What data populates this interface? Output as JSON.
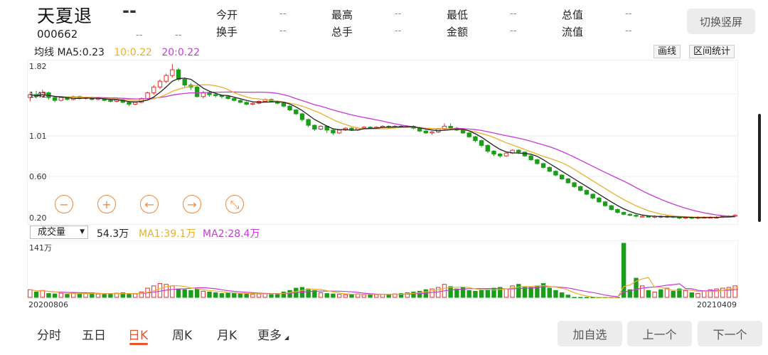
{
  "header": {
    "name": "天夏退",
    "price": "--",
    "code": "000662",
    "change": "--",
    "change_pct": "--",
    "quotes": [
      {
        "label": "今开",
        "value": "--"
      },
      {
        "label": "最高",
        "value": "--"
      },
      {
        "label": "最低",
        "value": "--"
      },
      {
        "label": "总值",
        "value": "--"
      },
      {
        "label": "换手",
        "value": "--"
      },
      {
        "label": "总手",
        "value": "--"
      },
      {
        "label": "金额",
        "value": "--"
      },
      {
        "label": "流值",
        "value": "--"
      }
    ],
    "switch_button": "切换竖屏"
  },
  "ma": {
    "label": "均线",
    "ma5": "MA5:0.23",
    "ma10": "10:0.22",
    "ma20": "20:0.22",
    "draw_button": "画线",
    "range_button": "区间统计"
  },
  "price_axis": [
    "1.82",
    "1.42",
    "1.01",
    "0.60",
    "0.20"
  ],
  "controls": [
    {
      "name": "zoom-out-icon",
      "glyph": "−"
    },
    {
      "name": "zoom-in-icon",
      "glyph": "+"
    },
    {
      "name": "arrow-left-icon",
      "glyph": "←"
    },
    {
      "name": "arrow-right-icon",
      "glyph": "→"
    },
    {
      "name": "collapse-icon",
      "glyph": "⤡"
    }
  ],
  "volume": {
    "selector": "成交量",
    "value": "54.3万",
    "ma1": "MA1:39.1万",
    "ma2": "MA2:28.4万",
    "max_label": "141万"
  },
  "dates": {
    "start": "20200806",
    "end": "20210409"
  },
  "tabs": [
    "分时",
    "五日",
    "日K",
    "周K",
    "月K",
    "更多"
  ],
  "active_tab": "日K",
  "buttons": {
    "watchlist": "加自选",
    "prev": "上一个",
    "next": "下一个"
  },
  "colors": {
    "up": "#e0312f",
    "down": "#1a9e1a",
    "ma5": "#222222",
    "ma10": "#e9b02e",
    "ma20": "#c83ad8",
    "accent": "#e8542c"
  },
  "chart_data": {
    "type": "candlestick",
    "price_ylim": [
      0.2,
      1.82
    ],
    "candles": [
      [
        1.47,
        1.5,
        1.43,
        1.52
      ],
      [
        1.5,
        1.48,
        1.46,
        1.54
      ],
      [
        1.48,
        1.52,
        1.47,
        1.55
      ],
      [
        1.52,
        1.47,
        1.45,
        1.53
      ],
      [
        1.47,
        1.44,
        1.42,
        1.49
      ],
      [
        1.44,
        1.47,
        1.43,
        1.48
      ],
      [
        1.47,
        1.45,
        1.44,
        1.48
      ],
      [
        1.45,
        1.48,
        1.44,
        1.49
      ],
      [
        1.48,
        1.46,
        1.45,
        1.49
      ],
      [
        1.46,
        1.47,
        1.45,
        1.48
      ],
      [
        1.47,
        1.45,
        1.44,
        1.48
      ],
      [
        1.45,
        1.46,
        1.44,
        1.47
      ],
      [
        1.46,
        1.44,
        1.43,
        1.47
      ],
      [
        1.44,
        1.43,
        1.42,
        1.45
      ],
      [
        1.43,
        1.45,
        1.42,
        1.46
      ],
      [
        1.45,
        1.42,
        1.41,
        1.46
      ],
      [
        1.42,
        1.4,
        1.38,
        1.43
      ],
      [
        1.4,
        1.42,
        1.39,
        1.43
      ],
      [
        1.42,
        1.46,
        1.41,
        1.47
      ],
      [
        1.46,
        1.52,
        1.45,
        1.53
      ],
      [
        1.52,
        1.58,
        1.5,
        1.6
      ],
      [
        1.58,
        1.64,
        1.56,
        1.66
      ],
      [
        1.64,
        1.7,
        1.62,
        1.72
      ],
      [
        1.7,
        1.76,
        1.68,
        1.82
      ],
      [
        1.76,
        1.66,
        1.64,
        1.78
      ],
      [
        1.66,
        1.6,
        1.58,
        1.68
      ],
      [
        1.6,
        1.58,
        1.55,
        1.62
      ],
      [
        1.58,
        1.48,
        1.47,
        1.6
      ],
      [
        1.48,
        1.52,
        1.46,
        1.54
      ],
      [
        1.52,
        1.5,
        1.48,
        1.54
      ],
      [
        1.5,
        1.49,
        1.47,
        1.52
      ],
      [
        1.49,
        1.48,
        1.46,
        1.5
      ],
      [
        1.48,
        1.46,
        1.45,
        1.49
      ],
      [
        1.46,
        1.44,
        1.43,
        1.47
      ],
      [
        1.44,
        1.42,
        1.41,
        1.45
      ],
      [
        1.42,
        1.4,
        1.39,
        1.43
      ],
      [
        1.4,
        1.41,
        1.39,
        1.42
      ],
      [
        1.41,
        1.43,
        1.4,
        1.44
      ],
      [
        1.43,
        1.45,
        1.42,
        1.46
      ],
      [
        1.45,
        1.43,
        1.42,
        1.46
      ],
      [
        1.43,
        1.41,
        1.4,
        1.44
      ],
      [
        1.41,
        1.38,
        1.37,
        1.42
      ],
      [
        1.38,
        1.34,
        1.33,
        1.39
      ],
      [
        1.34,
        1.3,
        1.29,
        1.35
      ],
      [
        1.3,
        1.24,
        1.22,
        1.31
      ],
      [
        1.24,
        1.18,
        1.16,
        1.25
      ],
      [
        1.18,
        1.14,
        1.12,
        1.19
      ],
      [
        1.14,
        1.17,
        1.13,
        1.18
      ],
      [
        1.17,
        1.13,
        1.1,
        1.18
      ],
      [
        1.13,
        1.1,
        1.08,
        1.14
      ],
      [
        1.1,
        1.13,
        1.09,
        1.14
      ],
      [
        1.13,
        1.15,
        1.12,
        1.16
      ],
      [
        1.15,
        1.13,
        1.12,
        1.16
      ],
      [
        1.13,
        1.15,
        1.12,
        1.16
      ],
      [
        1.15,
        1.16,
        1.14,
        1.17
      ],
      [
        1.16,
        1.15,
        1.14,
        1.17
      ],
      [
        1.15,
        1.16,
        1.14,
        1.17
      ],
      [
        1.16,
        1.17,
        1.15,
        1.18
      ],
      [
        1.17,
        1.16,
        1.15,
        1.18
      ],
      [
        1.16,
        1.17,
        1.15,
        1.18
      ],
      [
        1.17,
        1.16,
        1.15,
        1.18
      ],
      [
        1.16,
        1.17,
        1.15,
        1.18
      ],
      [
        1.17,
        1.15,
        1.14,
        1.18
      ],
      [
        1.15,
        1.12,
        1.11,
        1.16
      ],
      [
        1.12,
        1.1,
        1.09,
        1.13
      ],
      [
        1.1,
        1.11,
        1.08,
        1.12
      ],
      [
        1.11,
        1.14,
        1.1,
        1.15
      ],
      [
        1.14,
        1.17,
        1.13,
        1.2
      ],
      [
        1.17,
        1.15,
        1.13,
        1.2
      ],
      [
        1.15,
        1.13,
        1.12,
        1.16
      ],
      [
        1.13,
        1.1,
        1.09,
        1.14
      ],
      [
        1.1,
        1.06,
        1.05,
        1.11
      ],
      [
        1.06,
        1.02,
        1.0,
        1.07
      ],
      [
        1.02,
        0.97,
        0.95,
        1.03
      ],
      [
        0.97,
        0.91,
        0.89,
        0.98
      ],
      [
        0.91,
        0.88,
        0.86,
        0.92
      ],
      [
        0.88,
        0.86,
        0.84,
        0.89
      ],
      [
        0.86,
        0.89,
        0.85,
        0.9
      ],
      [
        0.89,
        0.92,
        0.88,
        0.93
      ],
      [
        0.92,
        0.9,
        0.88,
        0.93
      ],
      [
        0.9,
        0.86,
        0.85,
        0.91
      ],
      [
        0.86,
        0.82,
        0.81,
        0.87
      ],
      [
        0.82,
        0.78,
        0.77,
        0.83
      ],
      [
        0.78,
        0.74,
        0.73,
        0.79
      ],
      [
        0.74,
        0.7,
        0.69,
        0.75
      ],
      [
        0.7,
        0.66,
        0.65,
        0.71
      ],
      [
        0.66,
        0.62,
        0.61,
        0.67
      ],
      [
        0.62,
        0.58,
        0.57,
        0.63
      ],
      [
        0.58,
        0.54,
        0.53,
        0.59
      ],
      [
        0.54,
        0.5,
        0.49,
        0.55
      ],
      [
        0.5,
        0.46,
        0.45,
        0.51
      ],
      [
        0.46,
        0.42,
        0.41,
        0.47
      ],
      [
        0.42,
        0.38,
        0.37,
        0.43
      ],
      [
        0.38,
        0.34,
        0.33,
        0.39
      ],
      [
        0.34,
        0.3,
        0.29,
        0.35
      ],
      [
        0.3,
        0.27,
        0.26,
        0.31
      ],
      [
        0.27,
        0.25,
        0.24,
        0.28
      ],
      [
        0.25,
        0.24,
        0.23,
        0.26
      ],
      [
        0.24,
        0.23,
        0.22,
        0.25
      ],
      [
        0.23,
        0.23,
        0.22,
        0.24
      ],
      [
        0.23,
        0.22,
        0.22,
        0.24
      ],
      [
        0.22,
        0.23,
        0.21,
        0.24
      ],
      [
        0.23,
        0.22,
        0.21,
        0.24
      ],
      [
        0.22,
        0.23,
        0.21,
        0.24
      ],
      [
        0.23,
        0.22,
        0.21,
        0.24
      ],
      [
        0.22,
        0.21,
        0.2,
        0.23
      ],
      [
        0.21,
        0.22,
        0.2,
        0.23
      ],
      [
        0.22,
        0.21,
        0.2,
        0.23
      ],
      [
        0.21,
        0.22,
        0.2,
        0.23
      ],
      [
        0.22,
        0.22,
        0.21,
        0.23
      ],
      [
        0.22,
        0.22,
        0.21,
        0.23
      ],
      [
        0.22,
        0.22,
        0.21,
        0.23
      ],
      [
        0.22,
        0.23,
        0.21,
        0.24
      ],
      [
        0.23,
        0.23,
        0.22,
        0.24
      ],
      [
        0.23,
        0.24,
        0.22,
        0.25
      ]
    ],
    "volumes": [
      20,
      14,
      18,
      10,
      9,
      11,
      8,
      12,
      9,
      10,
      12,
      9,
      8,
      10,
      11,
      12,
      8,
      9,
      14,
      24,
      30,
      36,
      34,
      30,
      22,
      20,
      18,
      22,
      16,
      14,
      12,
      10,
      11,
      12,
      10,
      9,
      8,
      9,
      10,
      9,
      10,
      14,
      18,
      24,
      26,
      22,
      18,
      12,
      10,
      9,
      8,
      7,
      8,
      9,
      7,
      8,
      7,
      8,
      8,
      9,
      10,
      12,
      14,
      16,
      20,
      22,
      26,
      34,
      28,
      22,
      26,
      18,
      16,
      18,
      20,
      24,
      26,
      22,
      30,
      34,
      28,
      26,
      30,
      36,
      24,
      18,
      12,
      6,
      0,
      0,
      0,
      0,
      0,
      0,
      0,
      0,
      141,
      20,
      50,
      30,
      18,
      14,
      20,
      24,
      16,
      22,
      18,
      12,
      10,
      16,
      20,
      22,
      24,
      26,
      30,
      38
    ]
  }
}
